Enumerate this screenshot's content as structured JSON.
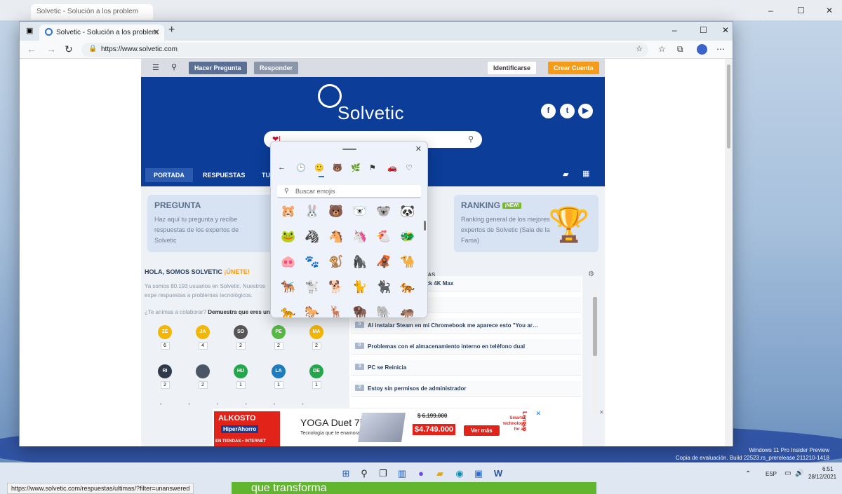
{
  "background_window": {
    "tab_label": "Solvetic - Solución a los problem",
    "controls": [
      "–",
      "☐",
      "✕"
    ]
  },
  "browser": {
    "tab_title": "Solvetic - Solución a los problem",
    "tab_close": "✕",
    "new_tab": "+",
    "url": "https://www.solvetic.com",
    "window_controls": [
      "–",
      "☐",
      "✕"
    ]
  },
  "site": {
    "topbar": {
      "ask": "Hacer Pregunta",
      "answer": "Responder",
      "login": "Identificarse",
      "signup": "Crear Cuenta"
    },
    "logo": "Solvetic",
    "search_value": "❤|",
    "menu": [
      "PORTADA",
      "RESPUESTAS",
      "TU"
    ],
    "cards": {
      "pregunta": {
        "title": "PREGUNTA",
        "text": "Haz aquí tu pregunta y recibe respuestas de los expertos de Solvetic"
      },
      "ranking": {
        "title": "RANKING",
        "badge": "¡NEW!",
        "text": "Ranking general de los mejores expertos de Solvetic (Sala de la Fama)"
      }
    },
    "hola": {
      "title": "HOLA, SOMOS SOLVETIC",
      "join": "¡ÚNETE!",
      "blurb": "Ya somos 80.193 usuarios en Solvetic. Nuestros expe respuestas a problemas tecnológicos.",
      "cta_a": "¿Te animas a colaborar?",
      "cta_b": "Demuestra que eres un ex"
    },
    "users": [
      {
        "initials": "ZE",
        "count": "6",
        "color": "#f2b705"
      },
      {
        "initials": "JA",
        "count": "4",
        "color": "#f2b705"
      },
      {
        "initials": "SO",
        "count": "2",
        "color": "#555555"
      },
      {
        "initials": "PE",
        "count": "2",
        "color": "#58b947"
      },
      {
        "initials": "MA",
        "count": "2",
        "color": "#f2b705"
      },
      {
        "initials": "RI",
        "count": "2",
        "color": "#2f3a4a"
      },
      {
        "initials": "",
        "count": "2",
        "color": "#4a5663"
      },
      {
        "initials": "HU",
        "count": "1",
        "color": "#22a84b"
      },
      {
        "initials": "LA",
        "count": "1",
        "color": "#1d7bbf"
      },
      {
        "initials": "DE",
        "count": "1",
        "color": "#22a84b"
      }
    ],
    "questions_heading_fragment": "SAS",
    "questions": [
      {
        "count": "",
        "text": "en amazon Fire TV Stick 4K Max"
      },
      {
        "count": "",
        "text": "omi Mi 2"
      },
      {
        "count": "0",
        "text": "Al instalar Steam en mi Chromebook me aparece esto \"You ar…"
      },
      {
        "count": "0",
        "text": "Problemas con el almacenamiento interno en teléfono dual"
      },
      {
        "count": "3",
        "text": "PC se Reinicia"
      },
      {
        "count": "2",
        "text": "Estoy sin permisos de administrador"
      }
    ],
    "ad": {
      "brand": "ALKOSTO",
      "brand2": "HiperAhorro",
      "tag": "EN TIENDAS • INTERNET",
      "product": "YOGA Duet 7i",
      "tagline": "Tecnología que te enamora",
      "old_price": "$ 6.199.000",
      "price": "$4.749.000",
      "cta": "Ver más",
      "side": "Smarter technology for all",
      "lenovo": "Lenovo"
    }
  },
  "emoji_panel": {
    "search_placeholder": "Buscar emojis",
    "categories": [
      "←",
      "🕒",
      "🙂",
      "🐻",
      "🌿",
      "⚑",
      "🚗",
      "♡"
    ],
    "emojis": [
      "🐹",
      "🐰",
      "🐻",
      "🐻‍❄️",
      "🐨",
      "🐼",
      "🐸",
      "🦓",
      "🐴",
      "🦄",
      "🐔",
      "🐲",
      "🐽",
      "🐾",
      "🐒",
      "🦍",
      "🦧",
      "🐪",
      "🐕‍🦺",
      "🐩",
      "🐕",
      "🐈",
      "🐈‍⬛",
      "🐅",
      "🐆",
      "🐎",
      "🦌",
      "🦬",
      "🐘",
      "🦛"
    ]
  },
  "status_url": "https://www.solvetic.com/respuestas/ultimas/?filter=unanswered",
  "watermark": [
    "Windows 11 Pro Insider Preview",
    "Copia de evaluación. Build 22523.rs_prerelease.211210-1418"
  ],
  "green_banner": "que transforma",
  "taskbar": {
    "lang": "ESP",
    "time": "6:51",
    "date": "28/12/2021"
  }
}
